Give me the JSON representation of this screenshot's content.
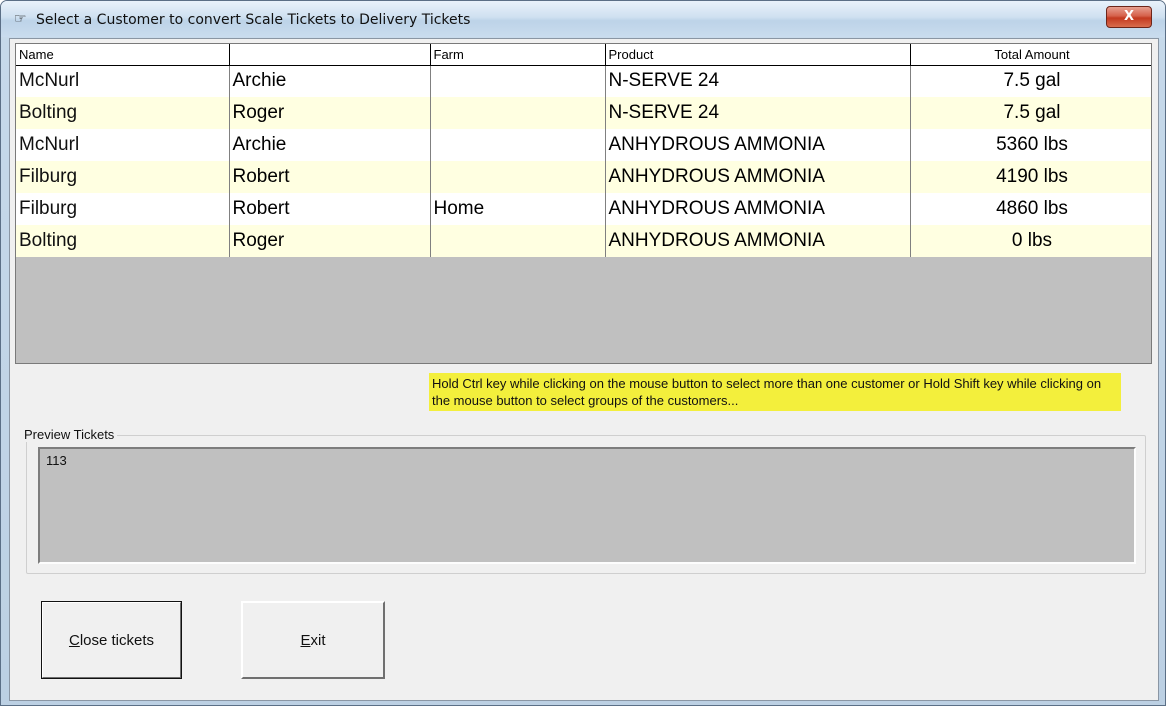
{
  "window": {
    "title": "Select a Customer to convert Scale Tickets to Delivery Tickets",
    "title_icon": "pointing-hand-icon",
    "close_label": "X"
  },
  "grid": {
    "columns": [
      "Name",
      "",
      "Farm",
      "Product",
      "Total Amount"
    ],
    "rows": [
      {
        "last": "McNurl",
        "first": "Archie",
        "farm": "",
        "product": "N-SERVE 24",
        "amount": "7.5 gal"
      },
      {
        "last": "Bolting",
        "first": "Roger",
        "farm": "",
        "product": "N-SERVE 24",
        "amount": "7.5 gal"
      },
      {
        "last": "McNurl",
        "first": "Archie",
        "farm": "",
        "product": "ANHYDROUS AMMONIA",
        "amount": "5360 lbs"
      },
      {
        "last": "Filburg",
        "first": "Robert",
        "farm": "",
        "product": "ANHYDROUS AMMONIA",
        "amount": "4190 lbs"
      },
      {
        "last": "Filburg",
        "first": "Robert",
        "farm": "Home",
        "product": "ANHYDROUS AMMONIA",
        "amount": "4860 lbs"
      },
      {
        "last": "Bolting",
        "first": "Roger",
        "farm": "",
        "product": "ANHYDROUS AMMONIA",
        "amount": "0 lbs"
      }
    ]
  },
  "hint": "Hold Ctrl key while clicking on the mouse button to select more than one customer or Hold Shift key while clicking on the mouse button to select groups of the customers...",
  "preview": {
    "label": "Preview Tickets",
    "value": "113"
  },
  "buttons": {
    "close_tickets_first": "C",
    "close_tickets_rest": "lose tickets",
    "exit_first": "E",
    "exit_rest": "xit"
  },
  "colors": {
    "row_alt": "#ffffe1",
    "hint_bg": "#f3ef3c",
    "grid_empty": "#c0c0c0"
  }
}
